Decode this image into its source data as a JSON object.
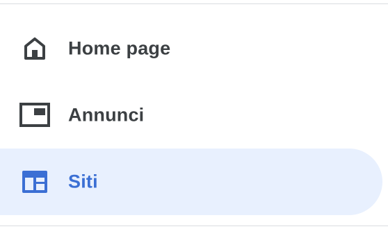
{
  "sidebar": {
    "items": [
      {
        "label": "Home page",
        "icon": "home-icon",
        "active": false
      },
      {
        "label": "Annunci",
        "icon": "ad-frame-icon",
        "active": false
      },
      {
        "label": "Siti",
        "icon": "web-layout-icon",
        "active": true
      }
    ]
  },
  "colors": {
    "text": "#3c4043",
    "active_text": "#3b6fd4",
    "active_background": "#e8f0fe",
    "divider": "#dadce0"
  }
}
